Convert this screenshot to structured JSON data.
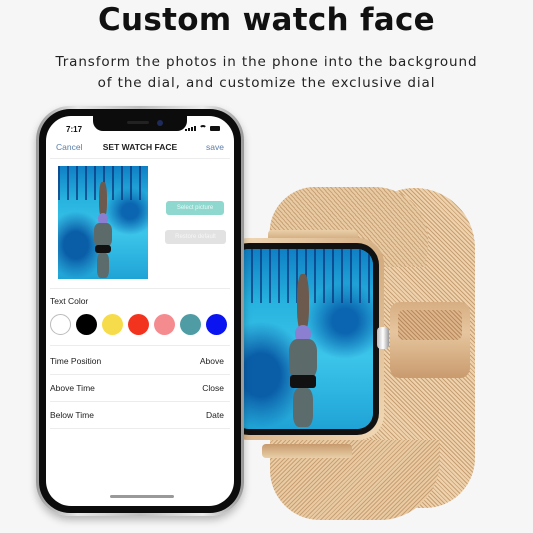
{
  "headline": "Custom watch face",
  "subline": {
    "line1": "Transform the photos in the phone into the background",
    "line2": "of the dial, and customize the exclusive dial"
  },
  "phone": {
    "status_time": "7:17",
    "nav": {
      "cancel": "Cancel",
      "title": "SET WATCH FACE",
      "save": "save"
    },
    "buttons": {
      "select_picture": "Select picture",
      "restore_default": "Restore default"
    },
    "text_color_label": "Text Color",
    "swatches": [
      "#ffffff",
      "#000000",
      "#f6dc4a",
      "#f2341f",
      "#f48b8f",
      "#4f9ca4",
      "#0a14f0"
    ],
    "settings": [
      {
        "label": "Time Position",
        "value": "Above"
      },
      {
        "label": "Above Time",
        "value": "Close"
      },
      {
        "label": "Below Time",
        "value": "Date"
      }
    ]
  }
}
